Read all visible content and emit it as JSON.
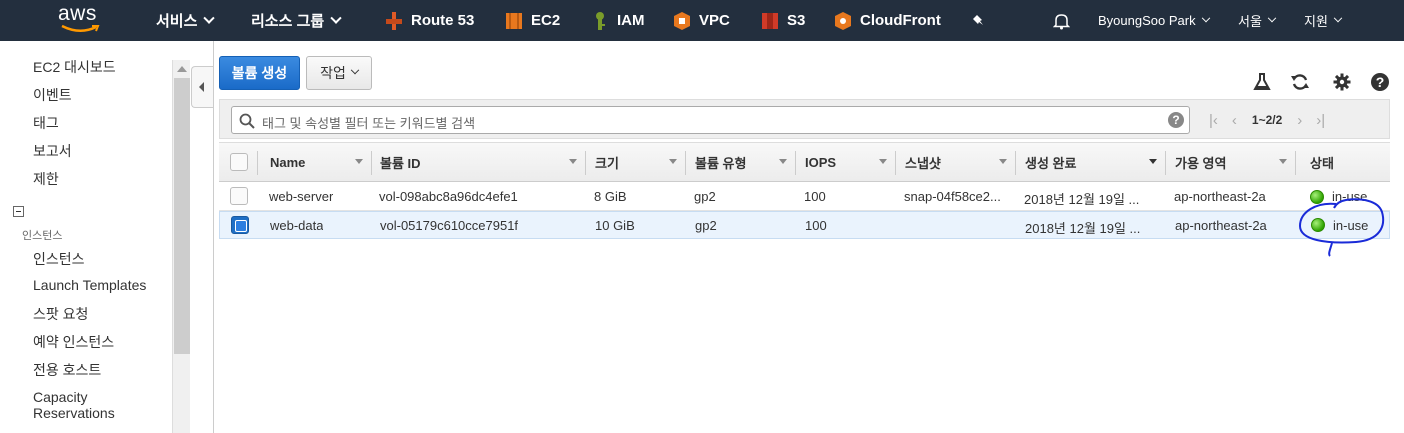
{
  "topnav": {
    "logo": "aws",
    "services": "서비스",
    "resource_groups": "리소스 그룹",
    "shortcuts": [
      {
        "label": "Route 53",
        "icon": "route53-icon",
        "color": "#e05a26"
      },
      {
        "label": "EC2",
        "icon": "ec2-icon",
        "color": "#e8781e"
      },
      {
        "label": "IAM",
        "icon": "iam-icon",
        "color": "#7a9c2a"
      },
      {
        "label": "VPC",
        "icon": "vpc-icon",
        "color": "#e8781e"
      },
      {
        "label": "S3",
        "icon": "s3-icon",
        "color": "#d13b28"
      },
      {
        "label": "CloudFront",
        "icon": "cloudfront-icon",
        "color": "#e8781e"
      }
    ],
    "user": "ByoungSoo Park",
    "region": "서울",
    "support": "지원"
  },
  "sidebar": {
    "items_top": [
      "EC2 대시보드",
      "이벤트",
      "태그",
      "보고서",
      "제한"
    ],
    "section": "인스턴스",
    "items_section": [
      "인스턴스",
      "Launch Templates",
      "스팟 요청",
      "예약 인스턴스",
      "전용 호스트",
      "Capacity Reservations"
    ]
  },
  "toolbar": {
    "create_label": "볼륨 생성",
    "actions_label": "작업"
  },
  "filter": {
    "placeholder": "태그 및 속성별 필터 또는 키워드별 검색",
    "help": "?",
    "page_range": "1~2/2"
  },
  "table": {
    "columns": [
      "Name",
      "볼륨 ID",
      "크기",
      "볼륨 유형",
      "IOPS",
      "스냅샷",
      "생성 완료",
      "가용 영역",
      "상태"
    ],
    "rows": [
      {
        "name": "web-server",
        "volume_id": "vol-098abc8a96dc4efe1",
        "size": "8 GiB",
        "type": "gp2",
        "iops": "100",
        "snapshot": "snap-04f58ce2...",
        "created": "2018년 12월 19일 ...",
        "az": "ap-northeast-2a",
        "state": "in-use",
        "selected": false
      },
      {
        "name": "web-data",
        "volume_id": "vol-05179c610cce7951f",
        "size": "10 GiB",
        "type": "gp2",
        "iops": "100",
        "snapshot": "",
        "created": "2018년 12월 19일 ...",
        "az": "ap-northeast-2a",
        "state": "in-use",
        "selected": true
      }
    ]
  }
}
